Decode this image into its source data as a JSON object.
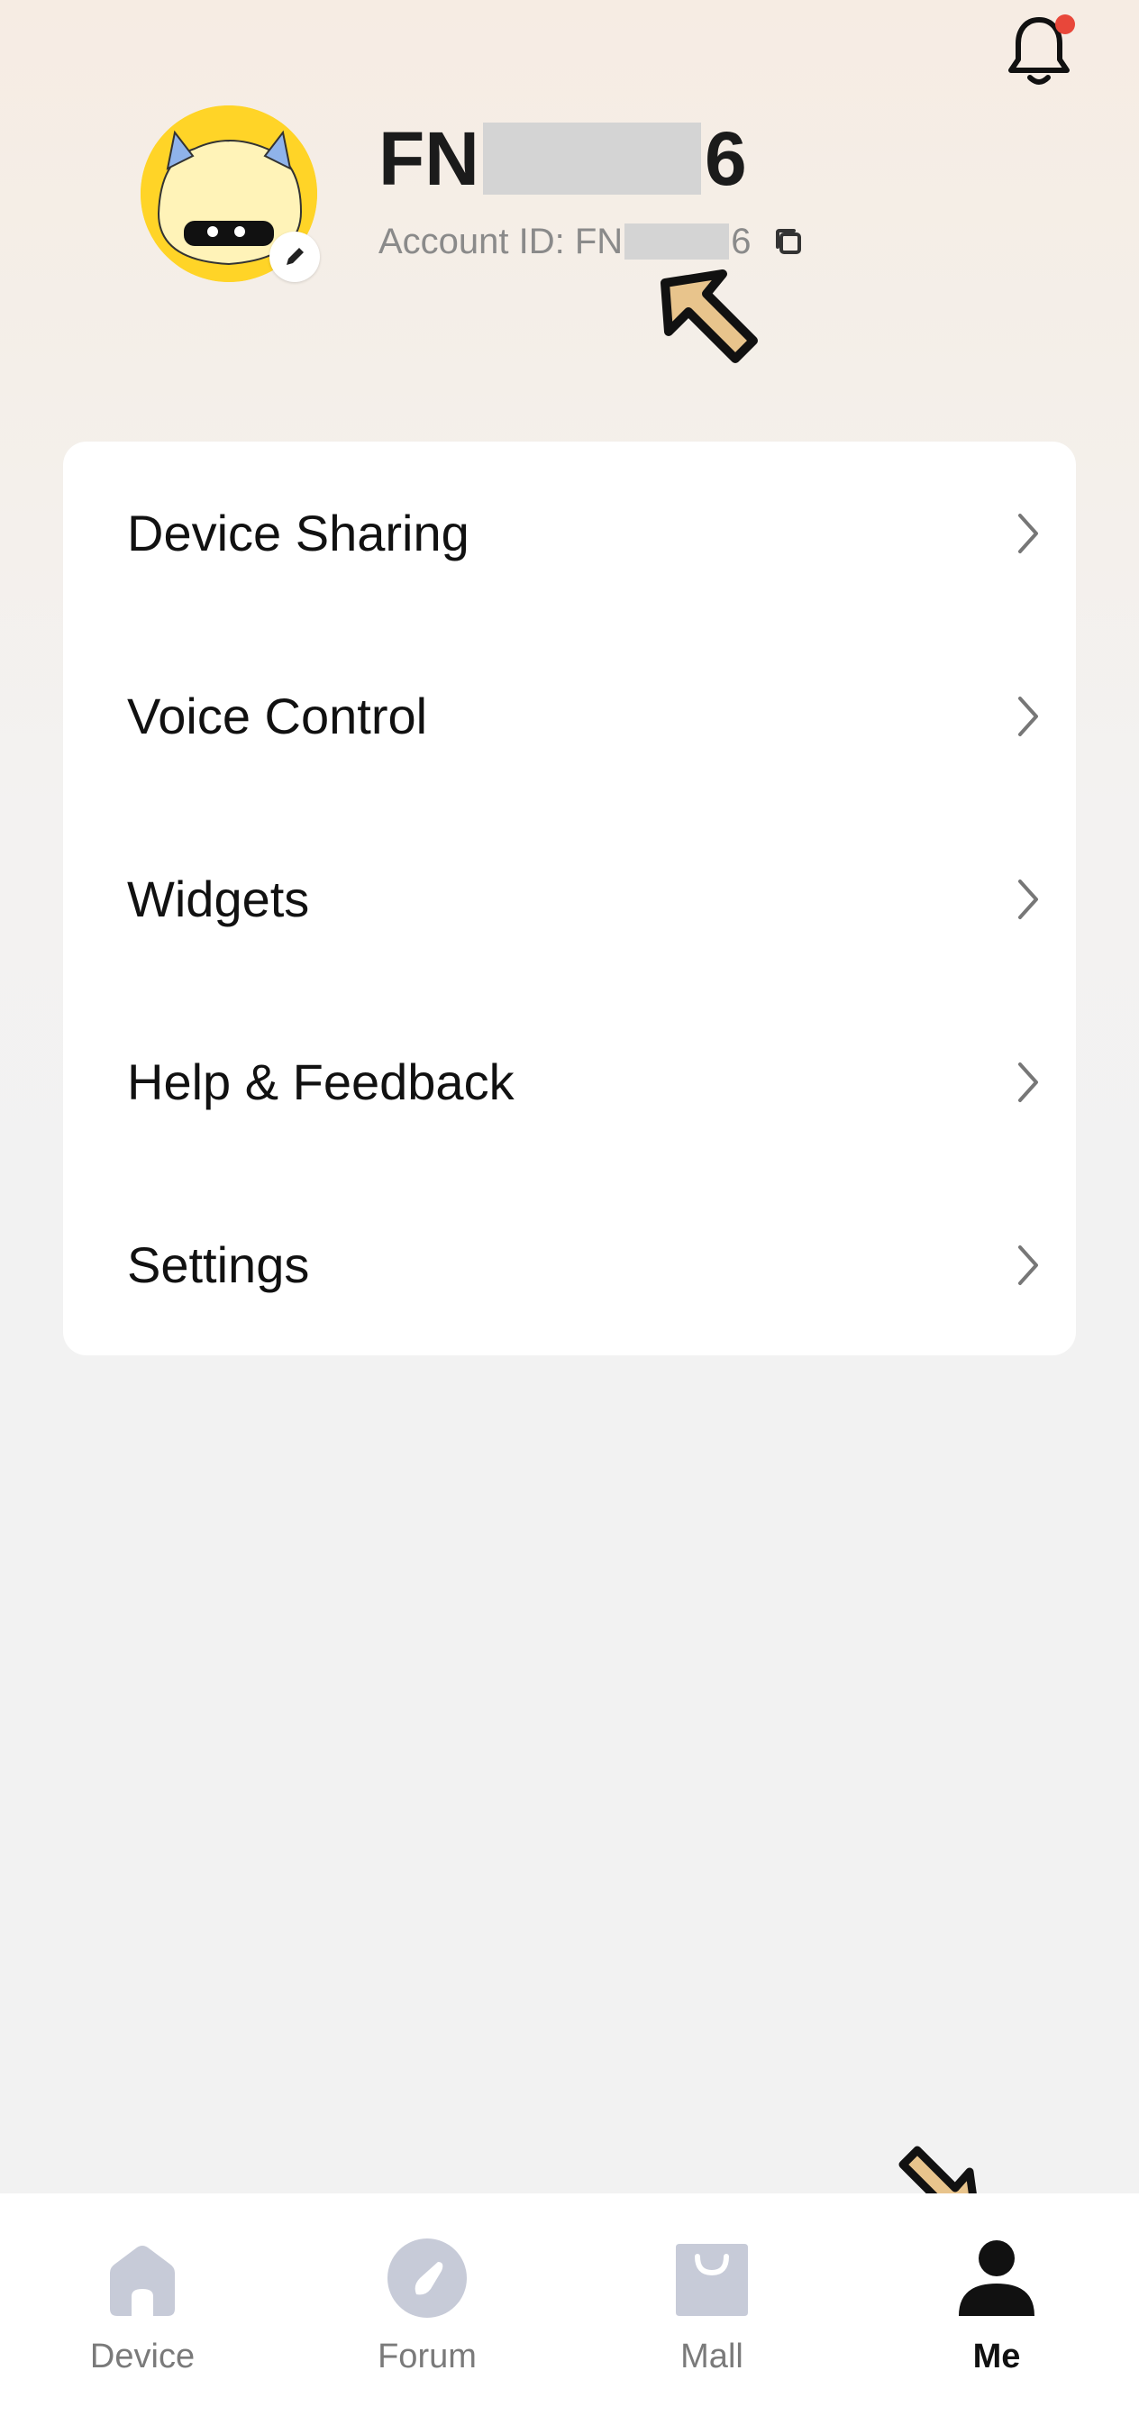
{
  "header": {
    "username_prefix": "FN",
    "username_suffix": "6",
    "account_id_label": "Account ID: FN",
    "account_id_suffix": "6",
    "notification_unread": true
  },
  "menu": {
    "items": [
      {
        "label": "Device Sharing"
      },
      {
        "label": "Voice Control"
      },
      {
        "label": "Widgets"
      },
      {
        "label": "Help & Feedback"
      },
      {
        "label": "Settings"
      }
    ]
  },
  "tabbar": {
    "tabs": [
      {
        "label": "Device",
        "icon": "home-icon",
        "active": false
      },
      {
        "label": "Forum",
        "icon": "compass-icon",
        "active": false
      },
      {
        "label": "Mall",
        "icon": "shopping-bag-icon",
        "active": false
      },
      {
        "label": "Me",
        "icon": "person-icon",
        "active": true
      }
    ]
  },
  "colors": {
    "accent": "#111111",
    "inactive_icon": "#c7cbd8",
    "notification_dot": "#e8473a",
    "avatar_bg": "#ffd427",
    "annotation_arrow": "#e8c48c"
  }
}
